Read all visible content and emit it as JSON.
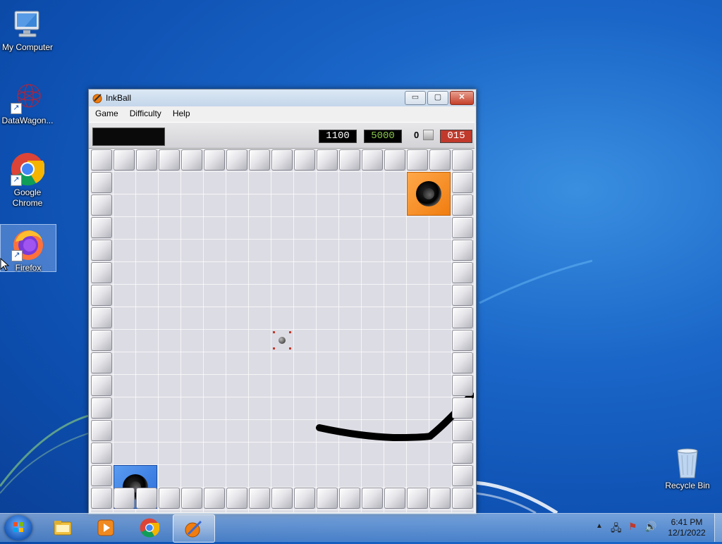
{
  "desktop": {
    "icons": [
      {
        "label": "My Computer"
      },
      {
        "label": "DataWagon..."
      },
      {
        "label": "Google Chrome"
      },
      {
        "label": "Firefox"
      },
      {
        "label": "Recycle Bin"
      }
    ]
  },
  "window": {
    "title": "InkBall",
    "controls": {
      "minimize": "▭",
      "maximize": "▢",
      "close": "✕"
    },
    "menu": [
      "Game",
      "Difficulty",
      "Help"
    ],
    "status": {
      "score": "1100",
      "target_score": "5000",
      "balls_count": "0",
      "timer": "015"
    }
  },
  "board": {
    "holes": [
      {
        "color": "orange",
        "hex": "#f08a20"
      },
      {
        "color": "blue",
        "hex": "#3a7ee0"
      }
    ],
    "ink_color": "#000000"
  },
  "taskbar": {
    "apps": [
      "windows-explorer",
      "media-player",
      "google-chrome",
      "inkball"
    ],
    "clock": {
      "time": "6:41 PM",
      "date": "12/1/2022"
    }
  }
}
